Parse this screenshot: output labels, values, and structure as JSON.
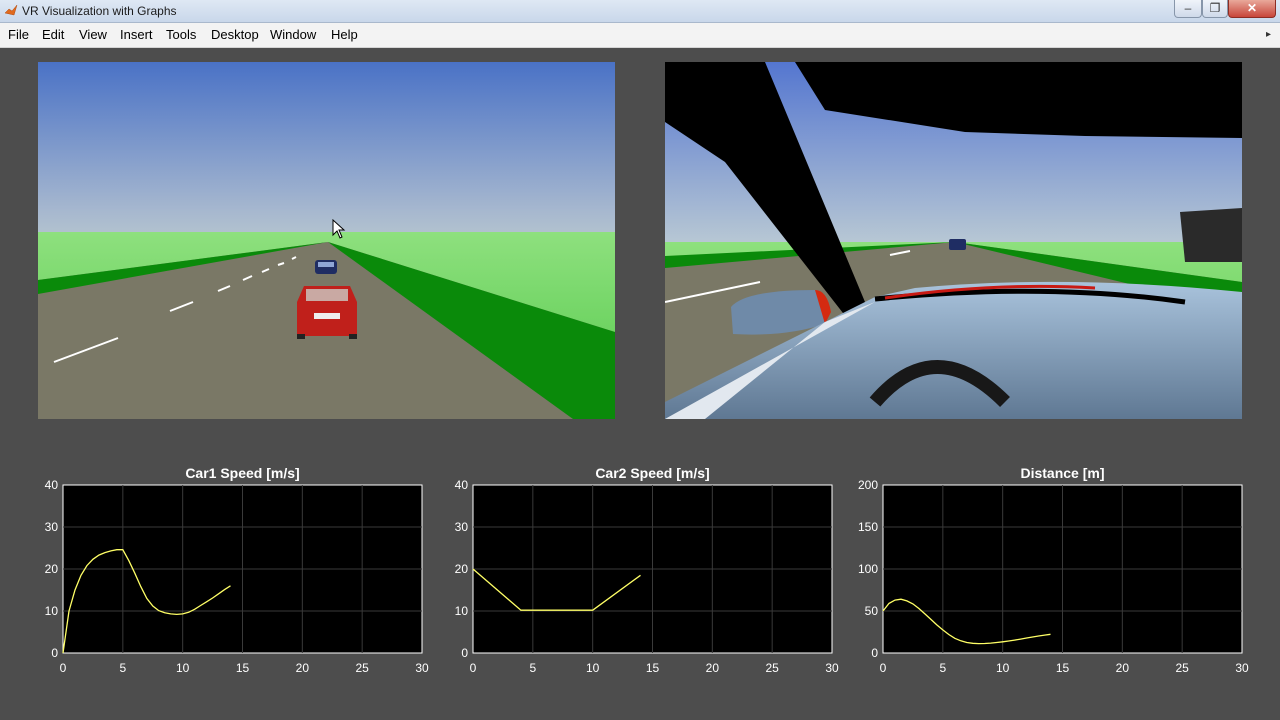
{
  "window": {
    "title": "VR Visualization with Graphs",
    "minimize_glyph": "–",
    "maximize_glyph": "❐",
    "close_glyph": "✕"
  },
  "menu": [
    "File",
    "Edit",
    "View",
    "Insert",
    "Tools",
    "Desktop",
    "Window",
    "Help"
  ],
  "menu_overflow_glyph": "▸",
  "views": {
    "left": {
      "description_icon": "chase-camera-view"
    },
    "right": {
      "description_icon": "driver-camera-view"
    }
  },
  "colors": {
    "figure_bg": "#4d4d4d",
    "axes_bg": "#000000",
    "line": "#ffff66",
    "sky_top": "#4d74c4",
    "grass": "#0a8a0a",
    "road": "#7a7866",
    "car_red": "#c0201b"
  },
  "chart_data": [
    {
      "type": "line",
      "title": "Car1 Speed [m/s]",
      "xlim": [
        0,
        30
      ],
      "ylim": [
        0,
        40
      ],
      "xticks": [
        0,
        5,
        10,
        15,
        20,
        25,
        30
      ],
      "yticks": [
        0,
        10,
        20,
        30,
        40
      ],
      "grid": true,
      "x": [
        0,
        0.5,
        1,
        1.5,
        2,
        2.5,
        3,
        3.5,
        4,
        4.5,
        5,
        5.5,
        6,
        6.5,
        7,
        7.5,
        8,
        8.5,
        9,
        9.5,
        10,
        10.5,
        11,
        11.5,
        12,
        12.5,
        13,
        13.5,
        14
      ],
      "y": [
        0,
        10,
        15,
        18.5,
        20.8,
        22.3,
        23.3,
        23.9,
        24.3,
        24.6,
        24.6,
        22,
        19,
        15.8,
        13,
        11.2,
        10.1,
        9.6,
        9.3,
        9.2,
        9.3,
        9.7,
        10.4,
        11.3,
        12.2,
        13.1,
        14.1,
        15.1,
        16
      ]
    },
    {
      "type": "line",
      "title": "Car2 Speed [m/s]",
      "xlim": [
        0,
        30
      ],
      "ylim": [
        0,
        40
      ],
      "xticks": [
        0,
        5,
        10,
        15,
        20,
        25,
        30
      ],
      "yticks": [
        0,
        10,
        20,
        30,
        40
      ],
      "grid": true,
      "x": [
        0,
        4,
        10,
        14
      ],
      "y": [
        20,
        10.2,
        10.2,
        18.5
      ]
    },
    {
      "type": "line",
      "title": "Distance [m]",
      "xlim": [
        0,
        30
      ],
      "ylim": [
        0,
        200
      ],
      "xticks": [
        0,
        5,
        10,
        15,
        20,
        25,
        30
      ],
      "yticks": [
        0,
        50,
        100,
        150,
        200
      ],
      "grid": true,
      "x": [
        0,
        0.5,
        1,
        1.5,
        2,
        2.5,
        3,
        3.5,
        4,
        4.5,
        5,
        5.5,
        6,
        6.5,
        7,
        7.5,
        8,
        8.5,
        9,
        9.5,
        10,
        10.5,
        11,
        11.5,
        12,
        12.5,
        13,
        13.5,
        14
      ],
      "y": [
        50,
        59,
        63,
        64,
        62,
        58.5,
        53,
        46.5,
        40,
        33.5,
        27.5,
        22,
        17.5,
        14.5,
        12.5,
        11.5,
        11.2,
        11.3,
        11.8,
        12.5,
        13.3,
        14.3,
        15.4,
        16.6,
        17.8,
        19,
        20.2,
        21.3,
        22.3
      ]
    }
  ]
}
